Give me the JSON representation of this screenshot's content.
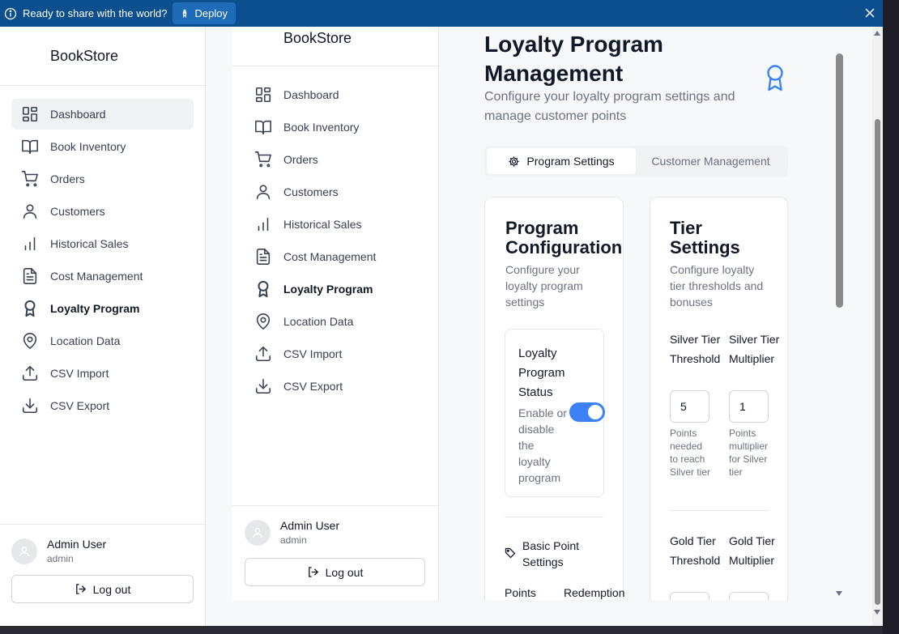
{
  "banner": {
    "message": "Ready to share with the world?",
    "deploy_label": "Deploy"
  },
  "app": {
    "brand": "BookStore"
  },
  "nav": [
    {
      "label": "Dashboard",
      "icon": "dashboard-icon"
    },
    {
      "label": "Book Inventory",
      "icon": "book-icon"
    },
    {
      "label": "Orders",
      "icon": "cart-icon"
    },
    {
      "label": "Customers",
      "icon": "user-icon"
    },
    {
      "label": "Historical Sales",
      "icon": "bar-chart-icon"
    },
    {
      "label": "Cost Management",
      "icon": "file-icon"
    },
    {
      "label": "Loyalty Program",
      "icon": "award-icon"
    },
    {
      "label": "Location Data",
      "icon": "map-pin-icon"
    },
    {
      "label": "CSV Import",
      "icon": "upload-icon"
    },
    {
      "label": "CSV Export",
      "icon": "download-icon"
    }
  ],
  "user": {
    "name": "Admin User",
    "role": "admin",
    "logout_label": "Log out"
  },
  "page": {
    "title": "Loyalty Program Management",
    "subtitle": "Configure your loyalty program settings and manage customer points"
  },
  "tabs": [
    {
      "label": "Program Settings"
    },
    {
      "label": "Customer Management"
    }
  ],
  "program_config": {
    "title": "Program Configuration",
    "description": "Configure your loyalty program settings",
    "status_title": "Loyalty Program Status",
    "status_description": "Enable or disable the loyalty program",
    "enabled": true,
    "basic_points_title": "Basic Point Settings",
    "col_points": "Points",
    "col_redemption": "Redemption"
  },
  "tier_settings": {
    "title": "Tier Settings",
    "description": "Configure loyalty tier thresholds and bonuses",
    "silver_threshold_label": "Silver Tier Threshold",
    "silver_threshold_value": "5",
    "silver_threshold_hint": "Points needed to reach Silver tier",
    "silver_multiplier_label": "Silver Tier Multiplier",
    "silver_multiplier_value": "1",
    "silver_multiplier_hint": "Points multiplier for Silver tier",
    "gold_threshold_label": "Gold Tier Threshold",
    "gold_multiplier_label": "Gold Tier Multiplier"
  }
}
